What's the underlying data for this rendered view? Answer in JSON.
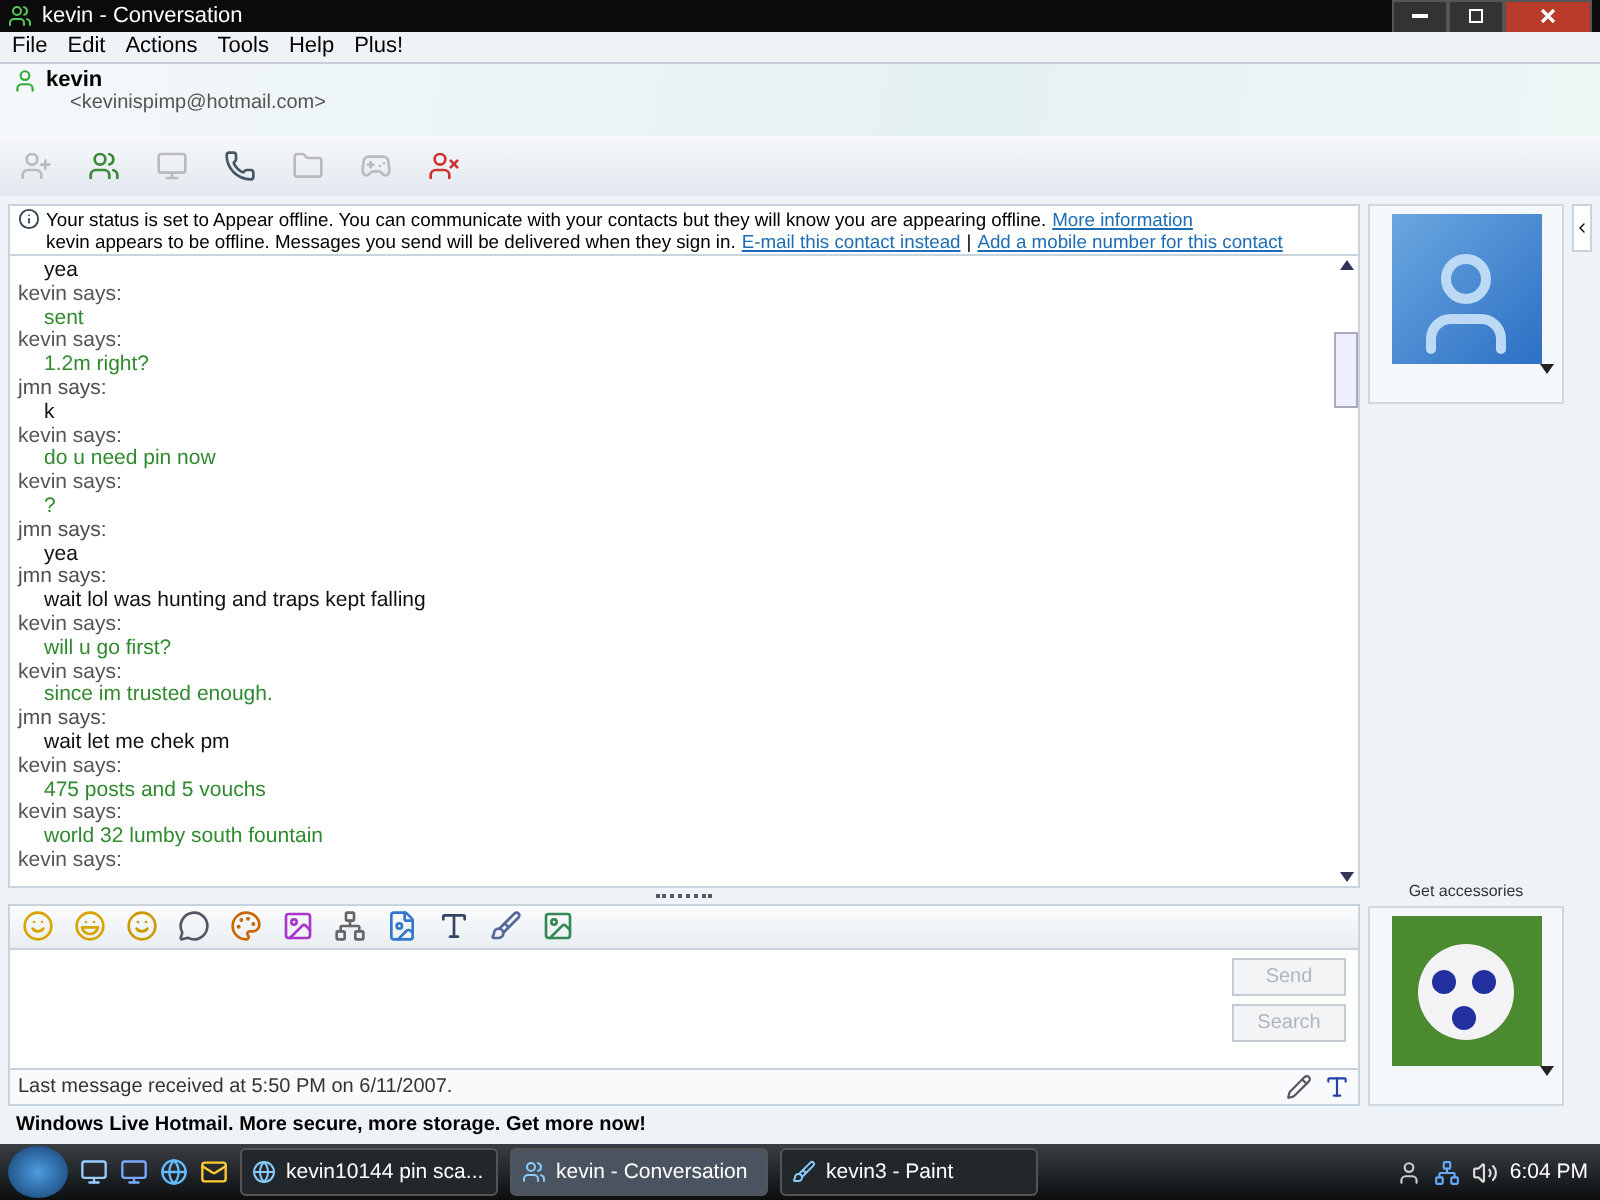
{
  "window": {
    "title": "kevin - Conversation"
  },
  "menu": [
    "File",
    "Edit",
    "Actions",
    "Tools",
    "Help",
    "Plus!"
  ],
  "contact": {
    "name": "kevin",
    "email": "<kevinispimp@hotmail.com>"
  },
  "info": {
    "line1": "Your status is set to Appear offline. You can communicate with your contacts but they will know you are appearing offline.",
    "link1": "More information",
    "line2": "kevin appears to be offline. Messages you send will be delivered when they sign in.",
    "link2": "E-mail this contact instead",
    "separator": "|",
    "link3": "Add a mobile number for this contact"
  },
  "messages": [
    {
      "kind": "remote",
      "text": "yea"
    },
    {
      "kind": "local",
      "sender": "kevin says:",
      "text": "sent"
    },
    {
      "kind": "local",
      "sender": "kevin says:",
      "text": "1.2m right?"
    },
    {
      "kind": "remote",
      "sender": "jmn says:",
      "text": "k"
    },
    {
      "kind": "local",
      "sender": "kevin says:",
      "text": "do u need pin now"
    },
    {
      "kind": "local",
      "sender": "kevin says:",
      "text": "?"
    },
    {
      "kind": "remote",
      "sender": "jmn says:",
      "text": "yea"
    },
    {
      "kind": "remote",
      "sender": "jmn says:",
      "text": "wait lol was hunting and traps kept falling"
    },
    {
      "kind": "local",
      "sender": "kevin says:",
      "text": "will u go first?"
    },
    {
      "kind": "local",
      "sender": "kevin says:",
      "text": "since im trusted enough."
    },
    {
      "kind": "remote",
      "sender": "jmn says:",
      "text": "wait let me chek pm"
    },
    {
      "kind": "local",
      "sender": "kevin says:",
      "text": "475 posts and 5 vouchs"
    },
    {
      "kind": "local",
      "sender": "kevin says:",
      "text": "world 32 lumby south fountain"
    },
    {
      "kind": "local",
      "sender": "kevin says:"
    }
  ],
  "compose": {
    "send": "Send",
    "search": "Search",
    "send_disabled": true,
    "search_disabled": true
  },
  "status": "Last message received at 5:50 PM on 6/11/2007.",
  "accessories": "Get accessories",
  "ad": "Windows Live Hotmail. More secure, more storage. Get more now!",
  "taskbar": {
    "items": [
      {
        "label": "kevin10144 pin sca...",
        "kind": "browser",
        "selected": false
      },
      {
        "label": "kevin - Conversation",
        "kind": "messenger",
        "selected": true
      },
      {
        "label": "kevin3 - Paint",
        "kind": "paint",
        "selected": false
      }
    ],
    "clock": "6:04 PM"
  }
}
